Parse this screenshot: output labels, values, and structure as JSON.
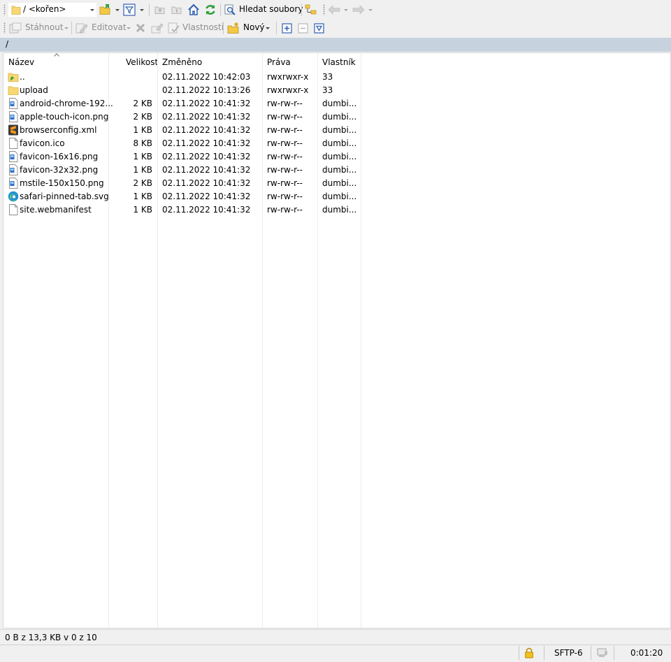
{
  "toolbar1": {
    "location_combo": "/ <kořen>",
    "search_label": "Hledat soubory"
  },
  "toolbar2": {
    "download_label": "Stáhnout",
    "edit_label": "Editovat",
    "properties_label": "Vlastnosti",
    "new_label": "Nový"
  },
  "path_bar": "/",
  "columns": {
    "name": "Název",
    "size": "Velikost",
    "changed": "Změněno",
    "rights": "Práva",
    "owner": "Vlastník"
  },
  "files": [
    {
      "name": "..",
      "size": "",
      "changed": "02.11.2022 10:42:03",
      "rights": "rwxrwxr-x",
      "owner": "33",
      "icon": "parent-folder-icon"
    },
    {
      "name": "upload",
      "size": "",
      "changed": "02.11.2022 10:13:26",
      "rights": "rwxrwxr-x",
      "owner": "33",
      "icon": "folder-icon"
    },
    {
      "name": "android-chrome-192...",
      "size": "2 KB",
      "changed": "02.11.2022 10:41:32",
      "rights": "rw-rw-r--",
      "owner": "dumbi...",
      "icon": "image-file-icon"
    },
    {
      "name": "apple-touch-icon.png",
      "size": "2 KB",
      "changed": "02.11.2022 10:41:32",
      "rights": "rw-rw-r--",
      "owner": "dumbi...",
      "icon": "image-file-icon"
    },
    {
      "name": "browserconfig.xml",
      "size": "1 KB",
      "changed": "02.11.2022 10:41:32",
      "rights": "rw-rw-r--",
      "owner": "dumbi...",
      "icon": "sublime-file-icon"
    },
    {
      "name": "favicon.ico",
      "size": "8 KB",
      "changed": "02.11.2022 10:41:32",
      "rights": "rw-rw-r--",
      "owner": "dumbi...",
      "icon": "blank-file-icon"
    },
    {
      "name": "favicon-16x16.png",
      "size": "1 KB",
      "changed": "02.11.2022 10:41:32",
      "rights": "rw-rw-r--",
      "owner": "dumbi...",
      "icon": "image-file-icon"
    },
    {
      "name": "favicon-32x32.png",
      "size": "1 KB",
      "changed": "02.11.2022 10:41:32",
      "rights": "rw-rw-r--",
      "owner": "dumbi...",
      "icon": "image-file-icon"
    },
    {
      "name": "mstile-150x150.png",
      "size": "2 KB",
      "changed": "02.11.2022 10:41:32",
      "rights": "rw-rw-r--",
      "owner": "dumbi...",
      "icon": "image-file-icon"
    },
    {
      "name": "safari-pinned-tab.svg",
      "size": "1 KB",
      "changed": "02.11.2022 10:41:32",
      "rights": "rw-rw-r--",
      "owner": "dumbi...",
      "icon": "edge-file-icon"
    },
    {
      "name": "site.webmanifest",
      "size": "1 KB",
      "changed": "02.11.2022 10:41:32",
      "rights": "rw-rw-r--",
      "owner": "dumbi...",
      "icon": "blank-file-icon"
    }
  ],
  "status": {
    "selection": "0 B z 13,3 KB v 0 z 10",
    "protocol": "SFTP-6",
    "elapsed": "0:01:20"
  },
  "colors": {
    "path_bar": "#c6d3df",
    "folder": "#f8d775",
    "accent_green": "#2e9e3a",
    "accent_blue": "#2f5fb3"
  }
}
